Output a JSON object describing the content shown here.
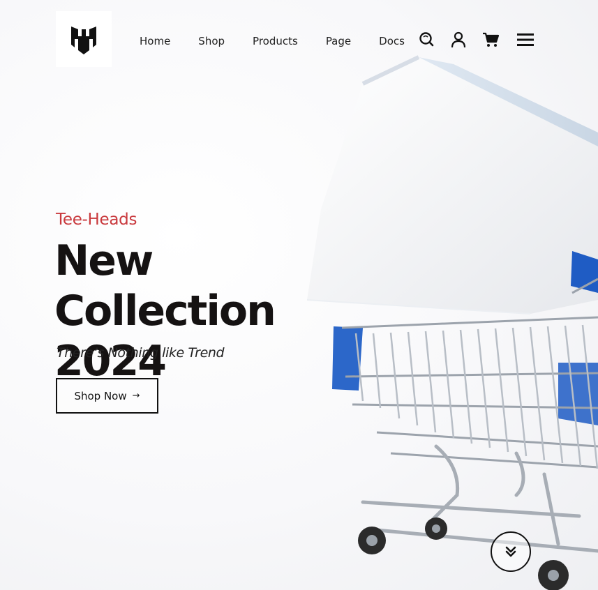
{
  "brand": {
    "logo_icon": "brand-logo-icon",
    "color": "#111111"
  },
  "nav": {
    "items": [
      {
        "label": "Home"
      },
      {
        "label": "Shop"
      },
      {
        "label": "Products"
      },
      {
        "label": "Page"
      },
      {
        "label": "Docs"
      }
    ]
  },
  "actions": {
    "icons": [
      "search-icon",
      "user-icon",
      "cart-icon",
      "menu-icon"
    ]
  },
  "hero": {
    "eyebrow": "Tee-Heads",
    "headline_line1": "New Collection",
    "headline_line2": "2024",
    "tagline": "There’s Nothing like Trend",
    "cta_label": "Shop Now",
    "cta_arrow": "→",
    "scroll_icon": "chevrons-down-icon"
  },
  "colors": {
    "accent": "#c9393d",
    "text": "#151212",
    "background": "#f7f7f8",
    "cart_blue": "#1f5cc4"
  }
}
